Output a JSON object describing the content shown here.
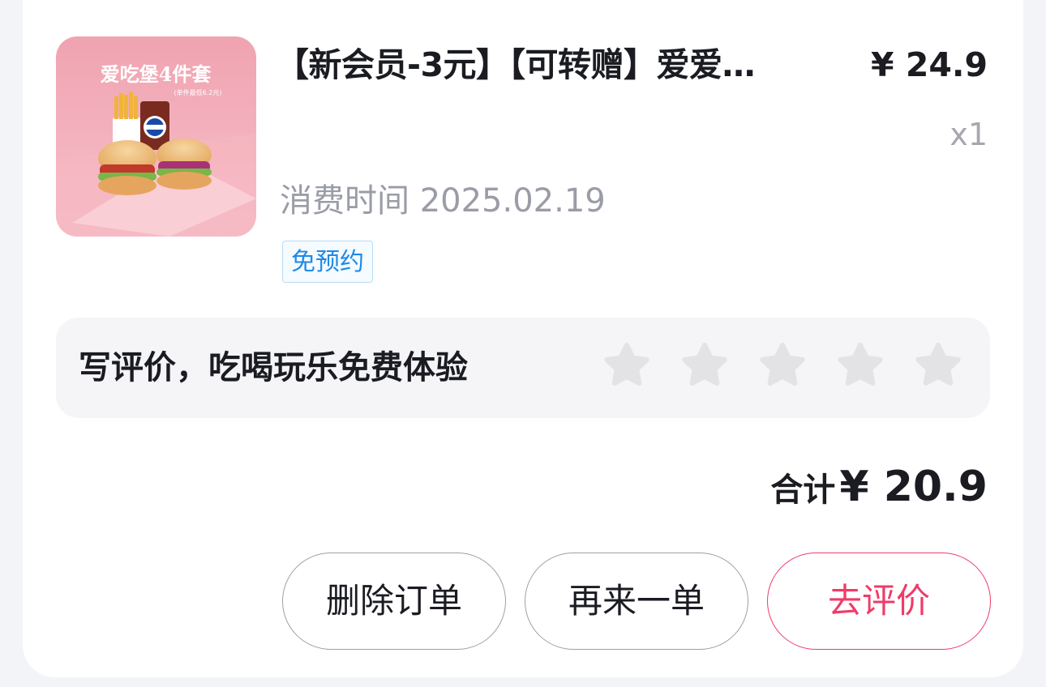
{
  "product": {
    "image_text": "爱吃堡4件套",
    "image_subtext": "(单件最低6.2元)",
    "title": "【新会员-3元】【可转赠】爱爱…",
    "price": "¥ 24.9",
    "quantity": "x1",
    "consume_time": "消费时间 2025.02.19",
    "tag": "免预约"
  },
  "review": {
    "prompt": "写评价，吃喝玩乐免费体验",
    "stars": 5,
    "star_color": "#e3e3e6"
  },
  "total": {
    "label": "合计",
    "value": "¥ 20.9"
  },
  "actions": {
    "delete_label": "删除订单",
    "reorder_label": "再来一单",
    "review_label": "去评价"
  },
  "colors": {
    "accent": "#ef3b69",
    "tag_blue": "#1f8ae8"
  }
}
